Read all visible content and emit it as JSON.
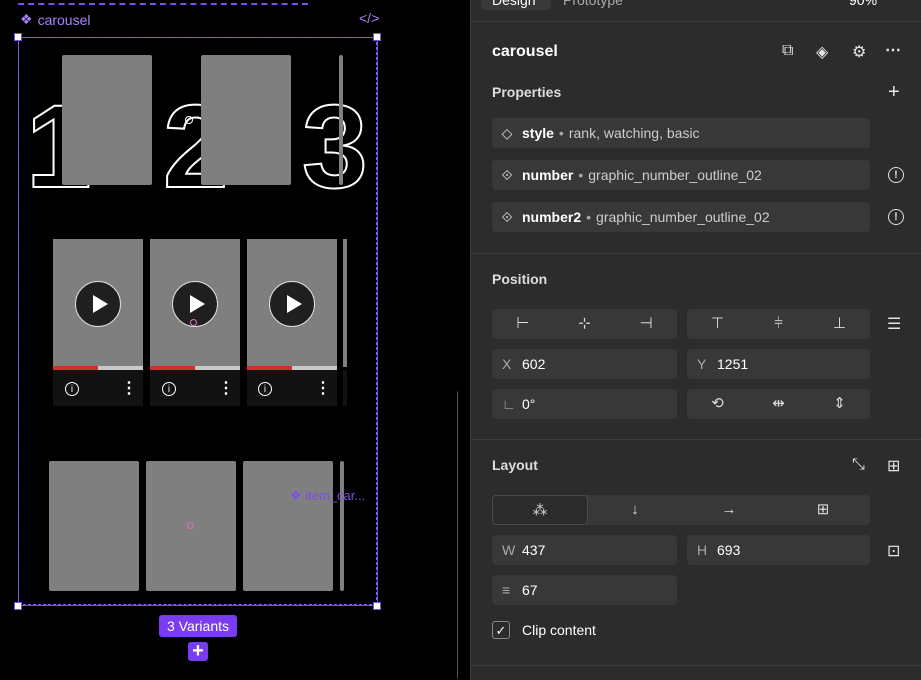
{
  "canvas": {
    "frame_label": "carousel",
    "component_glyph": "❖",
    "code_icon": "code-icon",
    "numbers": [
      "1",
      "2",
      "3"
    ],
    "video_progress": [
      0.5,
      0.5,
      0.5
    ],
    "item_label": "❖ item_car...",
    "variants_badge": "3 Variants",
    "add_variant": "+"
  },
  "panel": {
    "tabs": [
      "Design",
      "Prototype",
      "90%"
    ],
    "component_name": "carousel",
    "header_icons": [
      "component-set-icon",
      "component-icon",
      "adjust-icon",
      "more-icon"
    ],
    "properties": {
      "heading": "Properties",
      "add_icon": "+",
      "rows": [
        {
          "name": "style",
          "value": "rank, watching, basic",
          "icon": "variant-icon",
          "warning": false
        },
        {
          "name": "number",
          "value": "graphic_number_outline_02",
          "icon": "instance-swap-icon",
          "warning": true
        },
        {
          "name": "number2",
          "value": "graphic_number_outline_02",
          "icon": "instance-swap-icon",
          "warning": true
        }
      ]
    },
    "position": {
      "heading": "Position",
      "x_label": "X",
      "x_value": "602",
      "y_label": "Y",
      "y_value": "1251",
      "rotation": "0°"
    },
    "layout": {
      "heading": "Layout",
      "w_label": "W",
      "w_value": "437",
      "h_label": "H",
      "h_value": "693",
      "gap_value": "67",
      "clip_content_label": "Clip content",
      "clip_content": true
    }
  }
}
